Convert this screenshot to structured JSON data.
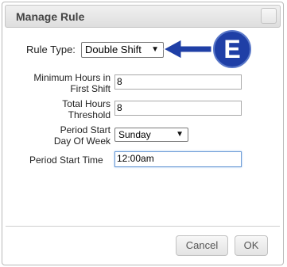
{
  "dialog": {
    "title": "Manage Rule"
  },
  "form": {
    "rule_type_label": "Rule Type:",
    "rule_type_value": "Double Shift",
    "min_hours_label_line1": "Minimum Hours in",
    "min_hours_label_line2": "First Shift",
    "min_hours_value": "8",
    "total_hours_label_line1": "Total Hours",
    "total_hours_label_line2": "Threshold",
    "total_hours_value": "8",
    "period_start_day_label_line1": "Period Start",
    "period_start_day_label_line2": "Day Of Week",
    "period_start_day_value": "Sunday",
    "period_start_time_label": "Period Start Time",
    "period_start_time_value": "12:00am"
  },
  "footer": {
    "cancel_label": "Cancel",
    "ok_label": "OK"
  },
  "annotation": {
    "badge_letter": "E",
    "arrow_color": "#1f3fa6",
    "badge_color": "#1f3fa6"
  }
}
